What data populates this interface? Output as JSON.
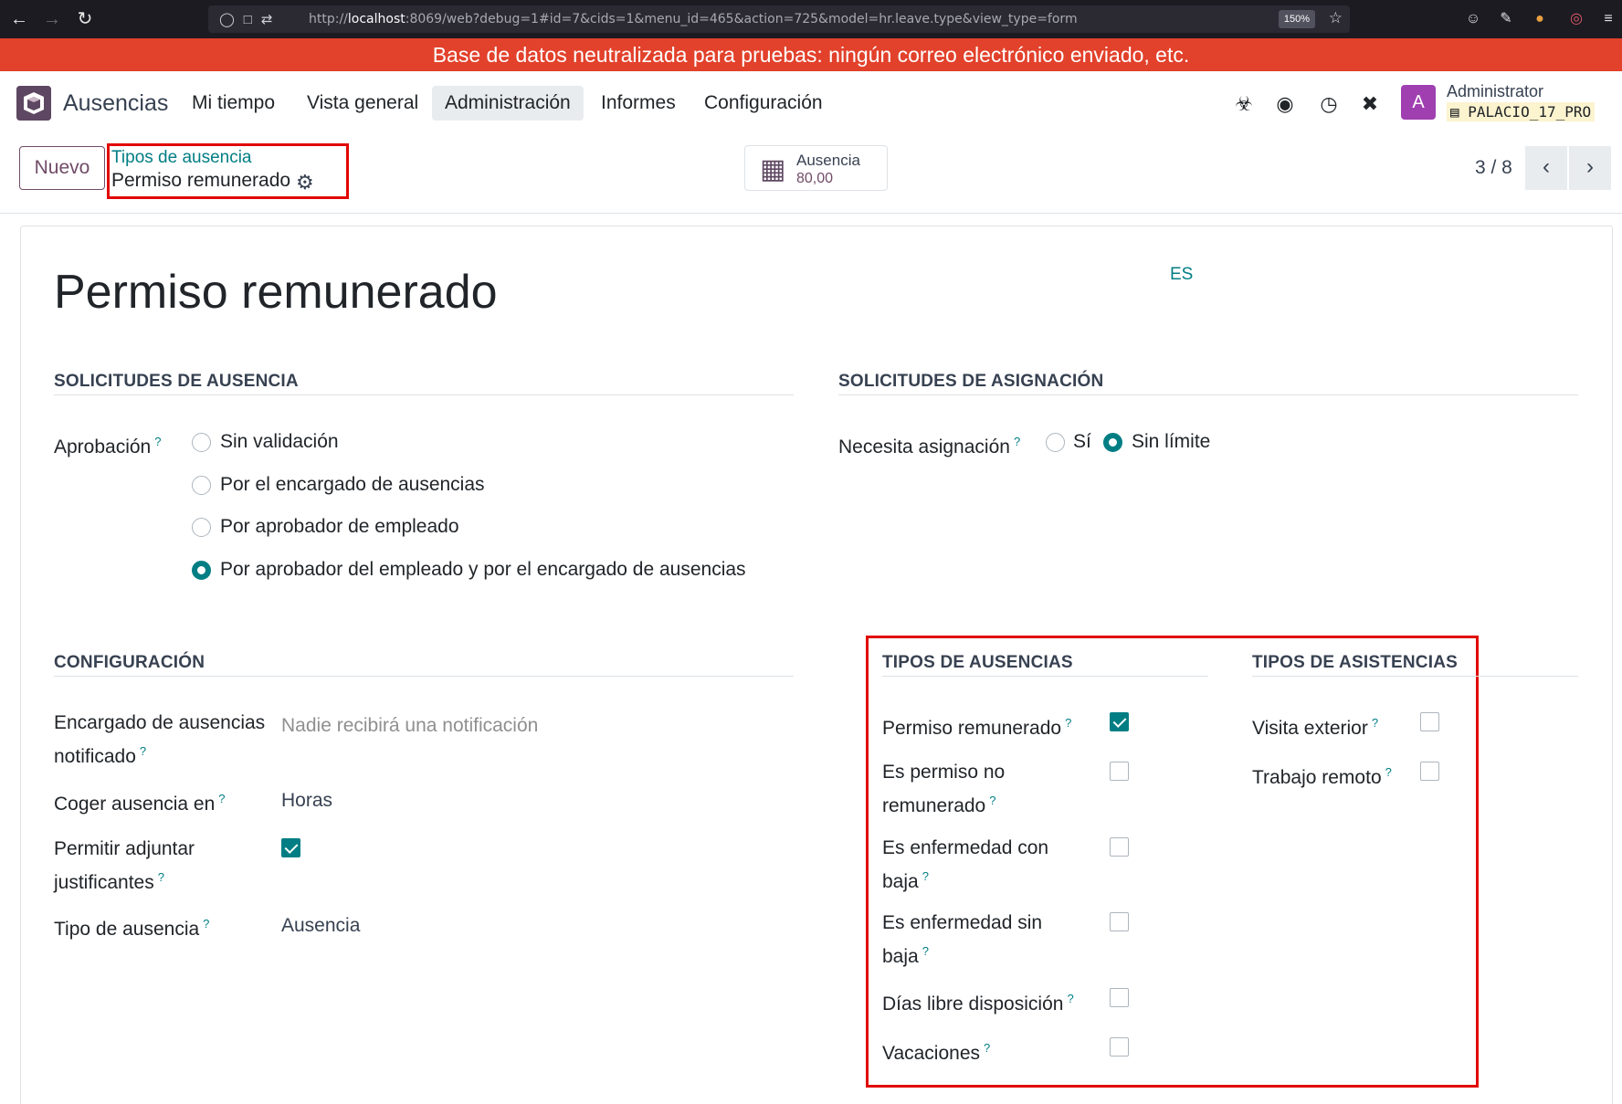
{
  "browser": {
    "url_prefix": "http://",
    "url_host": "localhost",
    "url_rest": ":8069/web?debug=1#id=7&cids=1&menu_id=465&action=725&model=hr.leave.type&view_type=form",
    "zoom": "150%"
  },
  "banner": {
    "text": "Base de datos neutralizada para pruebas: ningún correo electrónico enviado, etc."
  },
  "navbar": {
    "app_name": "Ausencias",
    "menu": [
      "Mi tiempo",
      "Vista general",
      "Administración",
      "Informes",
      "Configuración"
    ],
    "active_menu": "Administración",
    "user_initial": "A",
    "user_name": "Administrator",
    "database": "PALACIO_17_PRO"
  },
  "control_panel": {
    "new_label": "Nuevo",
    "breadcrumb_parent": "Tipos de ausencia",
    "breadcrumb_current": "Permiso remunerado",
    "smart_button": {
      "label": "Ausencia",
      "value": "80,00"
    },
    "pager": "3 / 8"
  },
  "form": {
    "title": "Permiso remunerado",
    "lang": "ES",
    "leave_requests": {
      "heading": "SOLICITUDES DE AUSENCIA",
      "approval_label": "Aprobación",
      "options": [
        "Sin validación",
        "Por el encargado de ausencias",
        "Por aprobador de empleado",
        "Por aprobador del empleado y por el encargado de ausencias"
      ],
      "selected_index": 3
    },
    "allocation_requests": {
      "heading": "SOLICITUDES DE ASIGNACIÓN",
      "label": "Necesita asignación",
      "options": [
        "Sí",
        "Sin límite"
      ],
      "selected_index": 1
    },
    "configuration": {
      "heading": "CONFIGURACIÓN",
      "notified_label_1": "Encargado de ausencias",
      "notified_label_2": "notificado",
      "notified_placeholder": "Nadie recibirá una notificación",
      "take_in_label": "Coger ausencia en",
      "take_in_value": "Horas",
      "attach_label_1": "Permitir adjuntar",
      "attach_label_2": "justificantes",
      "attach_checked": true,
      "type_label": "Tipo de ausencia",
      "type_value": "Ausencia"
    },
    "leave_types": {
      "heading": "TIPOS DE AUSENCIAS",
      "paid_leave": "Permiso remunerado",
      "unpaid_1": "Es permiso no",
      "unpaid_2": "remunerado",
      "sick_with_1": "Es enfermedad con",
      "sick_with_2": "baja",
      "sick_without_1": "Es enfermedad sin",
      "sick_without_2": "baja",
      "free_days": "Días libre disposición",
      "vacations": "Vacaciones",
      "checked": [
        true,
        false,
        false,
        false,
        false,
        false
      ]
    },
    "attendance_types": {
      "heading": "TIPOS DE ASISTENCIAS",
      "external_visit": "Visita exterior",
      "remote_work": "Trabajo remoto",
      "checked": [
        false,
        false
      ]
    },
    "help_mark": "?"
  }
}
